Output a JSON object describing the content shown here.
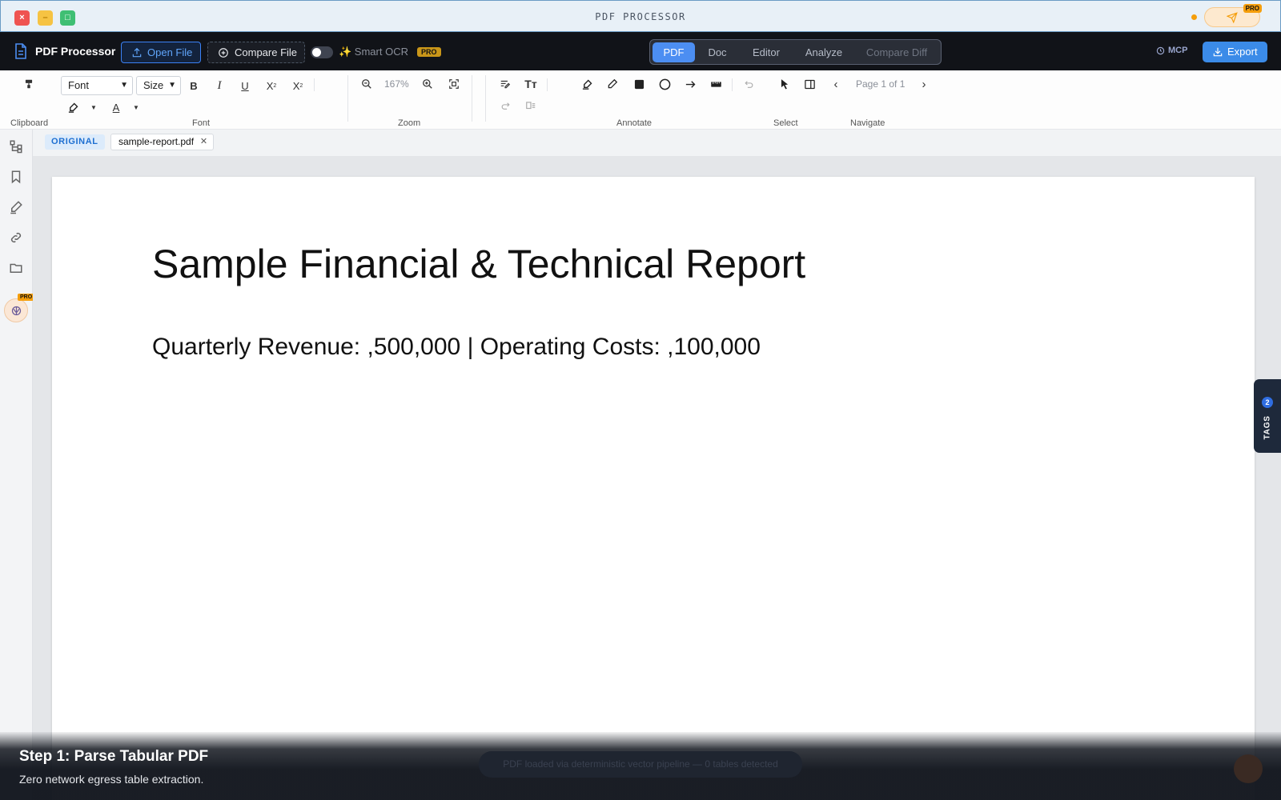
{
  "window": {
    "title": "PDF PROCESSOR",
    "send_pro_badge": "PRO"
  },
  "header": {
    "app_name": "PDF Processor",
    "open_file": "Open File",
    "compare_file": "Compare File",
    "smart_ocr": "✨ Smart OCR",
    "smart_ocr_badge": "PRO",
    "modes": [
      "PDF",
      "Doc",
      "Editor",
      "Analyze",
      "Compare Diff"
    ],
    "active_mode": "PDF",
    "mcp": "MCP",
    "export": "Export"
  },
  "ribbon": {
    "font_select": "Font",
    "size_select": "Size",
    "zoom_value": "167%",
    "page_indicator": "Page 1 of 1",
    "groups": {
      "clipboard": "Clipboard",
      "font": "Font",
      "zoom": "Zoom",
      "annotate": "Annotate",
      "select": "Select",
      "navigate": "Navigate"
    }
  },
  "rail": {
    "pro_badge": "PRO"
  },
  "doc_tabs": {
    "original_badge": "ORIGINAL",
    "file_name": "sample-report.pdf"
  },
  "document": {
    "title": "Sample Financial & Technical Report",
    "line": "Quarterly Revenue: ,500,000 | Operating Costs: ,100,000"
  },
  "tags": {
    "label": "TAGS",
    "count": "2"
  },
  "caption": {
    "title": "Step 1: Parse Tabular PDF",
    "subtitle": "Zero network egress table extraction.",
    "toast": "PDF loaded via deterministic vector pipeline — 0 tables detected"
  },
  "colors": {
    "accent": "#3b8be8",
    "pro": "#f59e0b",
    "appbar": "#111318"
  }
}
